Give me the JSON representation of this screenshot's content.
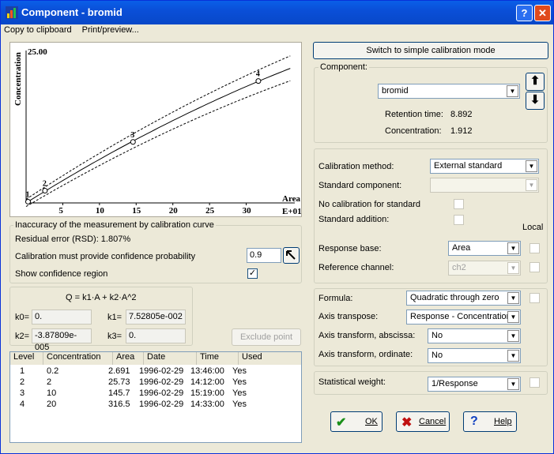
{
  "window": {
    "title": "Component - bromid",
    "help_btn": "?",
    "close_btn": "✕"
  },
  "menu": {
    "copy": "Copy to clipboard",
    "print": "Print/preview..."
  },
  "chart_data": {
    "type": "line",
    "ylabel": "Concentration",
    "xlabel": "Area",
    "x_multiplier": "E+01",
    "y_max_label": "25.00",
    "x_ticks": [
      "5",
      "10",
      "15",
      "20",
      "25",
      "30"
    ],
    "xlim": [
      0,
      35
    ],
    "ylim": [
      0,
      25
    ],
    "points": [
      {
        "label": "1",
        "x": 0.2691,
        "y": 0.2
      },
      {
        "label": "2",
        "x": 2.573,
        "y": 2
      },
      {
        "label": "3",
        "x": 14.57,
        "y": 10
      },
      {
        "label": "4",
        "x": 31.65,
        "y": 20
      }
    ],
    "k1": 0.0752805,
    "k2": -3.87809e-05
  },
  "inaccuracy": {
    "group_label": "Inaccuracy of the measurement by calibration curve",
    "residual": "Residual error (RSD): 1.807%",
    "prob_label": "Calibration must provide confidence probability",
    "prob_value": "0.9",
    "show_region": "Show confidence region",
    "show_region_checked": "✓"
  },
  "formula": {
    "text": "Q = k1·A + k2·A^2",
    "k0_label": "k0=",
    "k0": "0.",
    "k1_label": "k1=",
    "k1": "7.52805e-002",
    "k2_label": "k2=",
    "k2": "-3.87809e-005",
    "k3_label": "k3=",
    "k3": "0."
  },
  "exclude_btn": "Exclude point",
  "table": {
    "headers": [
      "Level",
      "Concentration",
      "Area",
      "Date",
      "Time",
      "Used"
    ],
    "rows": [
      [
        "1",
        "0.2",
        "2.691",
        "1996-02-29",
        "13:46:00",
        "Yes"
      ],
      [
        "2",
        "2",
        "25.73",
        "1996-02-29",
        "14:12:00",
        "Yes"
      ],
      [
        "3",
        "10",
        "145.7",
        "1996-02-29",
        "15:19:00",
        "Yes"
      ],
      [
        "4",
        "20",
        "316.5",
        "1996-02-29",
        "14:33:00",
        "Yes"
      ]
    ]
  },
  "right": {
    "simple_mode_btn": "Switch to simple calibration mode",
    "component_group": "Component:",
    "component_value": "bromid",
    "retention_label": "Retention time:",
    "retention_value": "8.892",
    "concentration_label": "Concentration:",
    "concentration_value": "1.912",
    "method_label": "Calibration method:",
    "method_value": "External standard",
    "std_component_label": "Standard component:",
    "no_cal_label": "No calibration for standard",
    "std_add_label": "Standard addition:",
    "local_label": "Local",
    "resp_base_label": "Response base:",
    "resp_base_value": "Area",
    "ref_channel_label": "Reference channel:",
    "ref_channel_value": "ch2",
    "formula_label": "Formula:",
    "formula_value": "Quadratic through zero",
    "axis_transpose_label": "Axis transpose:",
    "axis_transpose_value": "Response - Concentration",
    "abscissa_label": "Axis transform, abscissa:",
    "abscissa_value": "No",
    "ordinate_label": "Axis transform, ordinate:",
    "ordinate_value": "No",
    "weight_label": "Statistical weight:",
    "weight_value": "1/Response",
    "ok": "OK",
    "cancel": "Cancel",
    "help": "Help"
  }
}
